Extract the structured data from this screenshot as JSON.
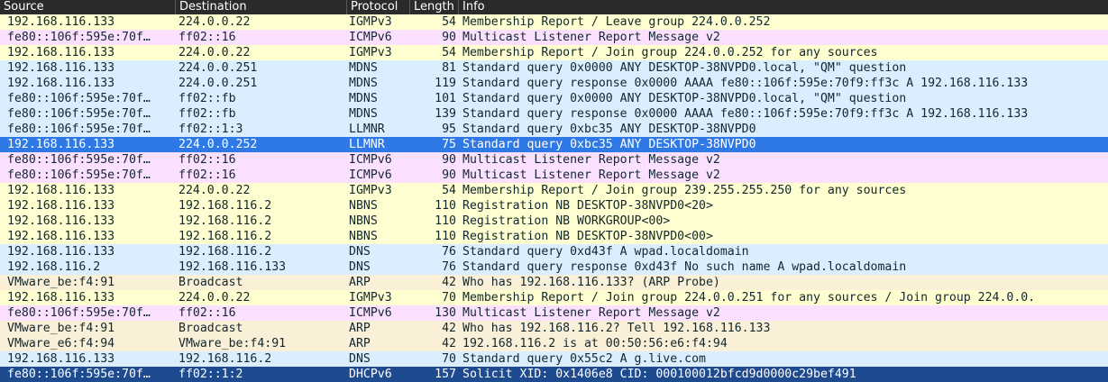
{
  "columns": {
    "source": "Source",
    "destination": "Destination",
    "protocol": "Protocol",
    "length": "Length",
    "info": "Info"
  },
  "colors": {
    "igmp": "#fefed0",
    "icmpv6": "#fce0ff",
    "udp": "#daeeff",
    "arp": "#faf0d7",
    "selected": "#2f79e6",
    "bottom": "#1e4a8f",
    "header": "#2b2b2b"
  },
  "rows": [
    {
      "source": "192.168.116.133",
      "destination": "224.0.0.22",
      "protocol": "IGMPv3",
      "length": "54",
      "info": "Membership Report / Leave group 224.0.0.252",
      "kind": "igmp"
    },
    {
      "source": "fe80::106f:595e:70f…",
      "destination": "ff02::16",
      "protocol": "ICMPv6",
      "length": "90",
      "info": "Multicast Listener Report Message v2",
      "kind": "icmpv6"
    },
    {
      "source": "192.168.116.133",
      "destination": "224.0.0.22",
      "protocol": "IGMPv3",
      "length": "54",
      "info": "Membership Report / Join group 224.0.0.252 for any sources",
      "kind": "igmp"
    },
    {
      "source": "192.168.116.133",
      "destination": "224.0.0.251",
      "protocol": "MDNS",
      "length": "81",
      "info": "Standard query 0x0000 ANY DESKTOP-38NVPD0.local, \"QM\" question",
      "kind": "udp"
    },
    {
      "source": "192.168.116.133",
      "destination": "224.0.0.251",
      "protocol": "MDNS",
      "length": "119",
      "info": "Standard query response 0x0000 AAAA fe80::106f:595e:70f9:ff3c A 192.168.116.133",
      "kind": "udp"
    },
    {
      "source": "fe80::106f:595e:70f…",
      "destination": "ff02::fb",
      "protocol": "MDNS",
      "length": "101",
      "info": "Standard query 0x0000 ANY DESKTOP-38NVPD0.local, \"QM\" question",
      "kind": "udp"
    },
    {
      "source": "fe80::106f:595e:70f…",
      "destination": "ff02::fb",
      "protocol": "MDNS",
      "length": "139",
      "info": "Standard query response 0x0000 AAAA fe80::106f:595e:70f9:ff3c A 192.168.116.133",
      "kind": "udp"
    },
    {
      "source": "fe80::106f:595e:70f…",
      "destination": "ff02::1:3",
      "protocol": "LLMNR",
      "length": "95",
      "info": "Standard query 0xbc35 ANY DESKTOP-38NVPD0",
      "kind": "udp"
    },
    {
      "source": "192.168.116.133",
      "destination": "224.0.0.252",
      "protocol": "LLMNR",
      "length": "75",
      "info": "Standard query 0xbc35 ANY DESKTOP-38NVPD0",
      "kind": "selected"
    },
    {
      "source": "fe80::106f:595e:70f…",
      "destination": "ff02::16",
      "protocol": "ICMPv6",
      "length": "90",
      "info": "Multicast Listener Report Message v2",
      "kind": "icmpv6"
    },
    {
      "source": "fe80::106f:595e:70f…",
      "destination": "ff02::16",
      "protocol": "ICMPv6",
      "length": "90",
      "info": "Multicast Listener Report Message v2",
      "kind": "icmpv6"
    },
    {
      "source": "192.168.116.133",
      "destination": "224.0.0.22",
      "protocol": "IGMPv3",
      "length": "54",
      "info": "Membership Report / Join group 239.255.255.250 for any sources",
      "kind": "igmp"
    },
    {
      "source": "192.168.116.133",
      "destination": "192.168.116.2",
      "protocol": "NBNS",
      "length": "110",
      "info": "Registration NB DESKTOP-38NVPD0<20>",
      "kind": "igmp"
    },
    {
      "source": "192.168.116.133",
      "destination": "192.168.116.2",
      "protocol": "NBNS",
      "length": "110",
      "info": "Registration NB WORKGROUP<00>",
      "kind": "igmp"
    },
    {
      "source": "192.168.116.133",
      "destination": "192.168.116.2",
      "protocol": "NBNS",
      "length": "110",
      "info": "Registration NB DESKTOP-38NVPD0<00>",
      "kind": "igmp"
    },
    {
      "source": "192.168.116.133",
      "destination": "192.168.116.2",
      "protocol": "DNS",
      "length": "76",
      "info": "Standard query 0xd43f A wpad.localdomain",
      "kind": "udp"
    },
    {
      "source": "192.168.116.2",
      "destination": "192.168.116.133",
      "protocol": "DNS",
      "length": "76",
      "info": "Standard query response 0xd43f No such name A wpad.localdomain",
      "kind": "udp"
    },
    {
      "source": "VMware_be:f4:91",
      "destination": "Broadcast",
      "protocol": "ARP",
      "length": "42",
      "info": "Who has 192.168.116.133? (ARP Probe)",
      "kind": "arp"
    },
    {
      "source": "192.168.116.133",
      "destination": "224.0.0.22",
      "protocol": "IGMPv3",
      "length": "70",
      "info": "Membership Report / Join group 224.0.0.251 for any sources / Join group 224.0.0.",
      "kind": "igmp"
    },
    {
      "source": "fe80::106f:595e:70f…",
      "destination": "ff02::16",
      "protocol": "ICMPv6",
      "length": "130",
      "info": "Multicast Listener Report Message v2",
      "kind": "icmpv6"
    },
    {
      "source": "VMware_be:f4:91",
      "destination": "Broadcast",
      "protocol": "ARP",
      "length": "42",
      "info": "Who has 192.168.116.2? Tell 192.168.116.133",
      "kind": "arp"
    },
    {
      "source": "VMware_e6:f4:94",
      "destination": "VMware_be:f4:91",
      "protocol": "ARP",
      "length": "42",
      "info": "192.168.116.2 is at 00:50:56:e6:f4:94",
      "kind": "arp"
    },
    {
      "source": "192.168.116.133",
      "destination": "192.168.116.2",
      "protocol": "DNS",
      "length": "70",
      "info": "Standard query 0x55c2 A g.live.com",
      "kind": "udp"
    },
    {
      "source": "fe80::106f:595e:70f…",
      "destination": "ff02::1:2",
      "protocol": "DHCPv6",
      "length": "157",
      "info": "Solicit XID: 0x1406e8 CID: 000100012bfcd9d0000c29bef491",
      "kind": "bottom"
    }
  ]
}
